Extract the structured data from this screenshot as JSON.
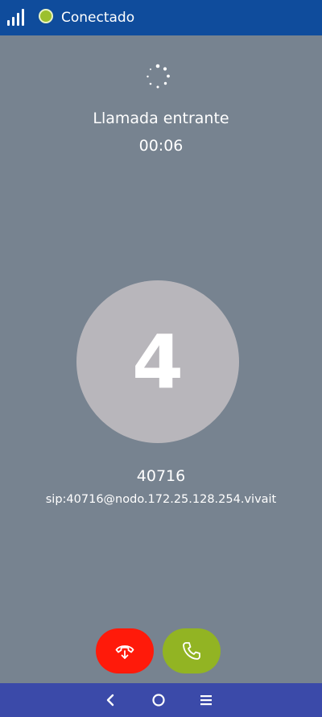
{
  "status_bar": {
    "connection_status": "Conectado",
    "status_color": "#9cc02e"
  },
  "call": {
    "state_label": "Llamada entrante",
    "timer": "00:06"
  },
  "caller": {
    "avatar_initial": "4",
    "number": "40716",
    "sip_uri": "sip:40716@nodo.172.25.128.254.vivait"
  },
  "actions": {
    "reject_icon": "phone-hangup-icon",
    "reject_color": "#ff1a0a",
    "answer_icon": "phone-answer-icon",
    "answer_color": "#92b423"
  },
  "navigation": {
    "items": [
      "back-icon",
      "home-icon",
      "recents-icon"
    ]
  }
}
